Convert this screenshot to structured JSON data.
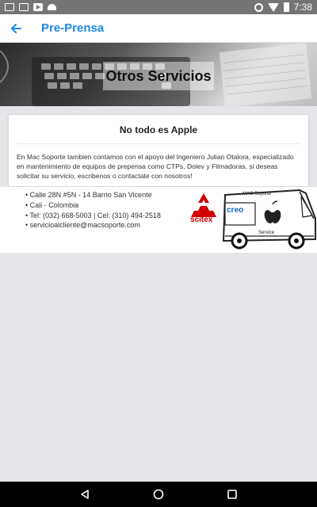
{
  "status_bar": {
    "time": "7:38"
  },
  "app_bar": {
    "title": "Pre-Prensa"
  },
  "hero": {
    "title": "Otros Servicios"
  },
  "card": {
    "title": "No todo es Apple",
    "body": "En Mac Soporte tambien contamos con el apoyo del Ingeniero Julian Otalora, especializado en mantenimiento de equipos de prepensa como CTPs, Dolev y Filmadoras, si deseas solicitar su servicio, escribenos o contactate con nosotros!"
  },
  "contact": {
    "address": "Calle 28N #5N - 14 Barrio San Vicente",
    "city": "Cali - Colombia",
    "phones": "Tel: (032) 668-5003 | Cel: (310) 494-2518",
    "email": "servicioalcliente@macsoporte.com"
  },
  "logos": {
    "scitex": "scitex",
    "creo": "creo",
    "van_label": "MAC Soporte",
    "service": "Service"
  },
  "colors": {
    "accent": "#1e88e5",
    "status_bar": "#757575",
    "nav_bar": "#000000"
  }
}
